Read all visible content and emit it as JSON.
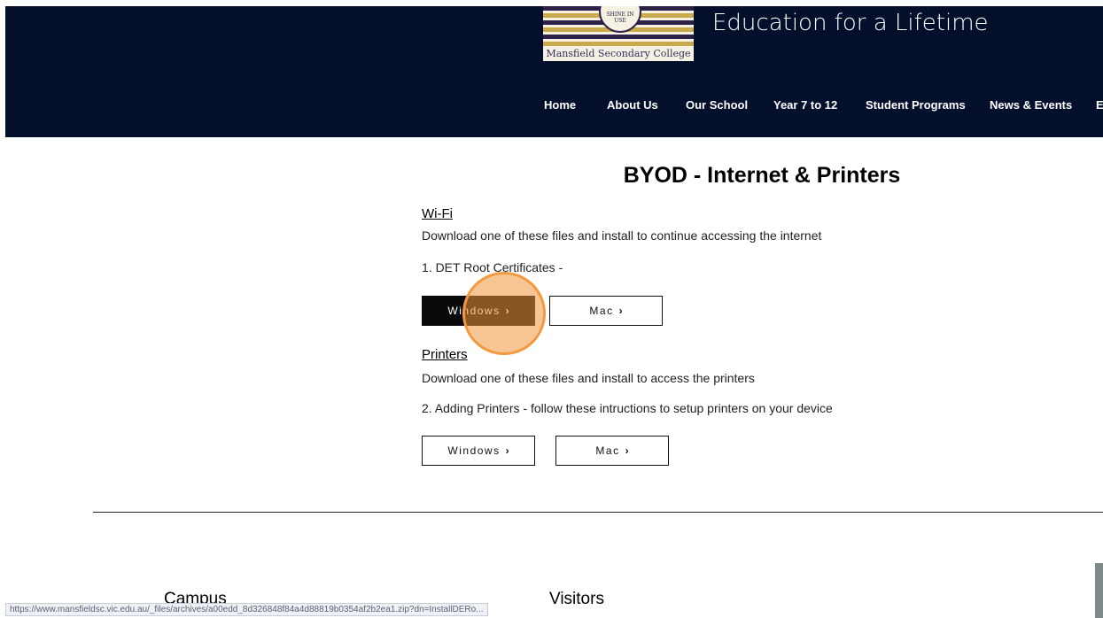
{
  "header": {
    "logo_name": "Mansfield Secondary College",
    "logo_motto": "SHINE IN USE",
    "tagline": "Education for a Lifetime",
    "nav": [
      "Home",
      "About Us",
      "Our School",
      "Year 7 to 12",
      "Student Programs",
      "News & Events",
      "E"
    ]
  },
  "page": {
    "title": "BYOD - Internet & Printers"
  },
  "wifi": {
    "heading": "Wi-Fi",
    "description": "Download one of these files and install to continue accessing the internet",
    "step": "1. DET Root Certificates -",
    "windows_label": "Windows",
    "mac_label": "Mac"
  },
  "printers": {
    "heading": "Printers",
    "description": "Download one of these files and install to access the printers",
    "step": "2. Adding Printers - follow these intructions to setup printers on your device",
    "windows_label": "Windows",
    "mac_label": "Mac"
  },
  "footer": {
    "campus": "Campus",
    "visitors": "Visitors"
  },
  "status_bar": {
    "url": "https://www.mansfieldsc.vic.edu.au/_files/archives/a00edd_8d326848f84a4d88819b0354af2b2ea1.zip?dn=InstallDERo..."
  },
  "colors": {
    "header_bg": "#040f2c",
    "button_dark": "#0a0a0a",
    "cursor_highlight": "#f39a40"
  },
  "icons": {
    "chevron": "chevron-right-icon"
  }
}
